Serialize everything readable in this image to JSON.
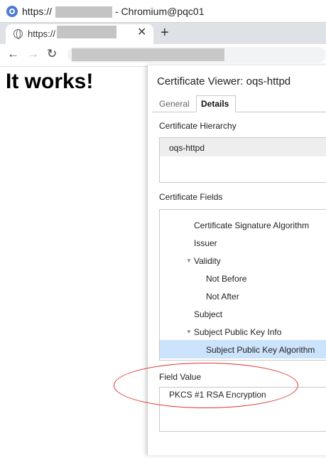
{
  "window": {
    "title_prefix": "https://",
    "title_suffix": "- Chromium@pqc01"
  },
  "tab": {
    "label": "https://",
    "close_glyph": "✕"
  },
  "toolbar": {
    "back_glyph": "←",
    "forward_glyph": "→",
    "reload_glyph": "↻",
    "new_tab_glyph": "+"
  },
  "page": {
    "heading": "It works!"
  },
  "dialog": {
    "title": "Certificate Viewer: oqs-httpd",
    "tabs": [
      {
        "label": "General",
        "selected": false
      },
      {
        "label": "Details",
        "selected": true
      }
    ],
    "hierarchy_label": "Certificate Hierarchy",
    "hierarchy_items": [
      "oqs-httpd"
    ],
    "fields_label": "Certificate Fields",
    "fields": [
      {
        "label": "Certificate Signature Algorithm",
        "expander": ""
      },
      {
        "label": "Issuer",
        "expander": ""
      },
      {
        "label": "Validity",
        "expander": "▼"
      },
      {
        "label": "Not Before",
        "expander": ""
      },
      {
        "label": "Not After",
        "expander": ""
      },
      {
        "label": "Subject",
        "expander": ""
      },
      {
        "label": "Subject Public Key Info",
        "expander": "▼"
      },
      {
        "label": "Subject Public Key Algorithm",
        "expander": "",
        "selected": true
      }
    ],
    "field_value_label": "Field Value",
    "field_value": "PKCS #1 RSA Encryption"
  },
  "annotation": {
    "ellipse_color": "#e03030"
  },
  "colors": {
    "tabstrip": "#dee1e6",
    "selection": "#cce4fb",
    "chromium_blue": "#4a7ad8"
  }
}
